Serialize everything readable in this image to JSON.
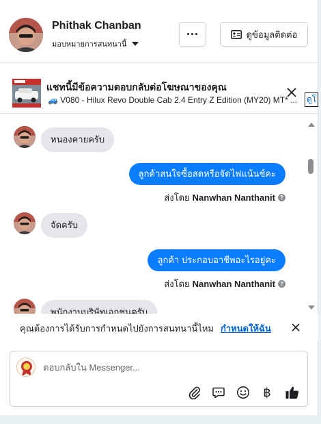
{
  "header": {
    "contact_name": "Phithak Chanban",
    "assign_label": "มอบหมายการสนทนานี้",
    "more_label": "···",
    "contact_info_label": "ดูข้อมูลติดต่อ"
  },
  "ad_reply": {
    "title": "แชทนี้มีข้อความตอบกลับต่อโฆษณาของคุณ",
    "subtitle": "🚙 V080 - Hilux Revo Double Cab 2.4 Entry Z Edition (MY20) MT* ...",
    "link_label": "ดูโ"
  },
  "thread": {
    "messages": [
      {
        "direction": "in",
        "text": "หนองคายครับ"
      },
      {
        "direction": "out",
        "text": "ลูกค้าสนใจซื้อสดหรือจัดไฟแน้นช์คะ",
        "sent_by_prefix": "ส่งโดย",
        "sent_by_name": "Nanwhan Nanthanit"
      },
      {
        "direction": "in",
        "text": "จัดครับ"
      },
      {
        "direction": "out",
        "text": "ลูกค้า ประกอบอาชีพอะไรอยู่คะ",
        "sent_by_prefix": "ส่งโดย",
        "sent_by_name": "Nanwhan Nanthanit"
      },
      {
        "direction": "in",
        "text": "พนักงานบริษัทเอกชนครับ"
      }
    ]
  },
  "assign_prompt": {
    "text": "คุณต้องการได้รับการกำหนดไปยังการสนทนานี้ไหม",
    "link_label": "กำหนดให้ฉัน"
  },
  "composer": {
    "placeholder": "ตอบกลับใน Messenger...",
    "tools": [
      "paperclip-icon",
      "chat-bubble-icon",
      "emoji-icon",
      "baht-icon",
      "thumbs-up-icon"
    ],
    "currency_symbol": "฿"
  },
  "colors": {
    "accent": "#0a7cff",
    "link": "#0064d1",
    "incoming_bubble": "#e4e6eb"
  }
}
